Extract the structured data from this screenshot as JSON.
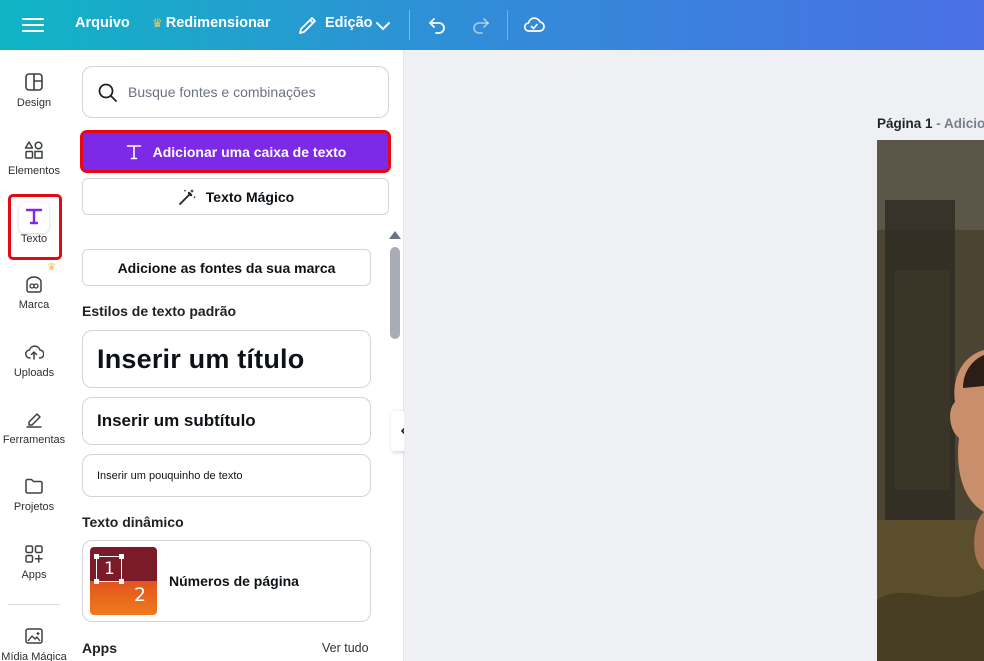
{
  "topbar": {
    "file_label": "Arquivo",
    "resize_label": "Redimensionar",
    "edit_label": "Edição"
  },
  "rail": {
    "items": [
      {
        "label": "Design"
      },
      {
        "label": "Elementos"
      },
      {
        "label": "Texto"
      },
      {
        "label": "Marca"
      },
      {
        "label": "Uploads"
      },
      {
        "label": "Ferramentas"
      },
      {
        "label": "Projetos"
      },
      {
        "label": "Apps"
      },
      {
        "label": "Mídia Mágica"
      }
    ]
  },
  "panel": {
    "search_placeholder": "Busque fontes e combinações",
    "add_textbox_label": "Adicionar uma caixa de texto",
    "magic_text_label": "Texto Mágico",
    "brand_fonts_label": "Adicione as fontes da sua marca",
    "default_styles_title": "Estilos de texto padrão",
    "styles": {
      "title": "Inserir um título",
      "subtitle": "Inserir um subtítulo",
      "body": "Inserir um pouquinho de texto"
    },
    "dynamic_title": "Texto dinâmico",
    "dynamic_item": {
      "label": "Números de página",
      "thumb_num1": "1",
      "thumb_num2": "2"
    },
    "apps_title": "Apps",
    "see_all": "Ver tudo"
  },
  "canvas": {
    "page_label": "Página 1",
    "page_title_hint": "- Adicion"
  },
  "colors": {
    "accent_purple": "#7d2ae8",
    "highlight_red": "#e50914",
    "topbar_start": "#10b5c5",
    "topbar_end": "#4a6fe6"
  }
}
